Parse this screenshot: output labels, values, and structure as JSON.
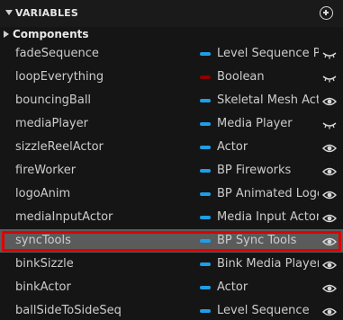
{
  "header": {
    "title": "VARIABLES"
  },
  "category": {
    "label": "Components"
  },
  "colors": {
    "object_pin": "#1e9ee6",
    "boolean_pin": "#8c0000",
    "selected_row": "#5b5b5b",
    "highlight": "#e00000"
  },
  "variables": [
    {
      "name": "fadeSequence",
      "type": "Level Sequence Pla",
      "pin": "object",
      "visibility": "eye-closed-icon"
    },
    {
      "name": "loopEverything",
      "type": "Boolean",
      "pin": "boolean",
      "visibility": "eye-closed-icon"
    },
    {
      "name": "bouncingBall",
      "type": "Skeletal Mesh Acto",
      "pin": "object",
      "visibility": "eye-open-icon"
    },
    {
      "name": "mediaPlayer",
      "type": "Media Player",
      "pin": "object",
      "visibility": "eye-closed-icon"
    },
    {
      "name": "sizzleReelActor",
      "type": "Actor",
      "pin": "object",
      "visibility": "eye-open-icon"
    },
    {
      "name": "fireWorker",
      "type": "BP Fireworks",
      "pin": "object",
      "visibility": "eye-open-icon"
    },
    {
      "name": "logoAnim",
      "type": "BP Animated Logo",
      "pin": "object",
      "visibility": "eye-open-icon"
    },
    {
      "name": "mediaInputActor",
      "type": "Media Input Actor",
      "pin": "object",
      "visibility": "eye-open-icon"
    },
    {
      "name": "syncTools",
      "type": "BP Sync Tools",
      "pin": "object",
      "visibility": "eye-open-icon",
      "selected": true
    },
    {
      "name": "binkSizzle",
      "type": "Bink Media Player",
      "pin": "object",
      "visibility": "eye-open-icon"
    },
    {
      "name": "binkActor",
      "type": "Actor",
      "pin": "object",
      "visibility": "eye-open-icon"
    },
    {
      "name": "ballSideToSideSeq",
      "type": "Level Sequence",
      "pin": "object",
      "visibility": "eye-open-icon"
    }
  ]
}
